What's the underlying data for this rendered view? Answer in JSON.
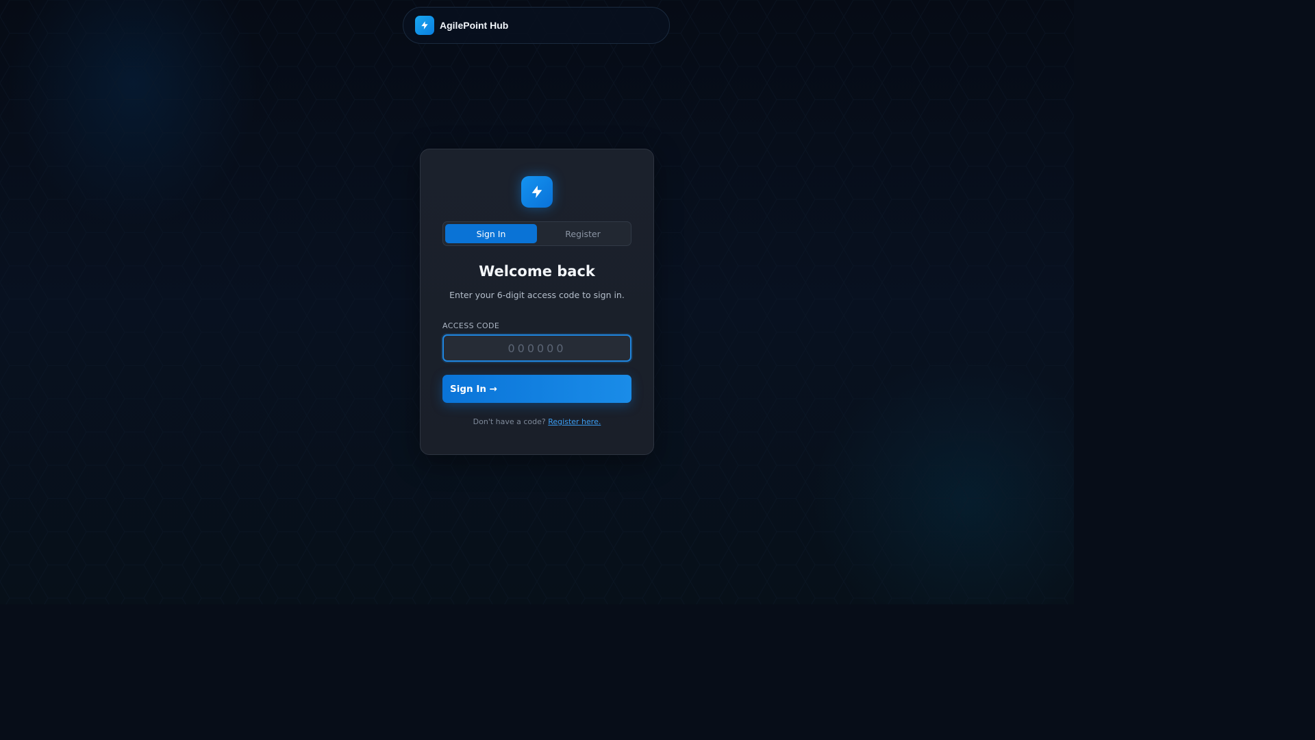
{
  "app": {
    "name": "AgilePoint Hub"
  },
  "header": {
    "brand_icon": "bolt-icon"
  },
  "auth": {
    "logo_icon": "bolt-icon",
    "tabs": [
      {
        "label": "Sign In",
        "active": true
      },
      {
        "label": "Register",
        "active": false
      }
    ],
    "title": "Welcome back",
    "subtitle": "Enter your 6-digit access code to sign in.",
    "access_code": {
      "label": "ACCESS CODE",
      "placeholder": "000000",
      "value": ""
    },
    "submit_label": "Sign In →",
    "footer": {
      "prompt": "Don't have a code?",
      "link_label": "Register here."
    }
  },
  "colors": {
    "accent": "#0a73d6",
    "background": "#070d18",
    "card": "#1b212c",
    "link": "#3b9cf0"
  }
}
